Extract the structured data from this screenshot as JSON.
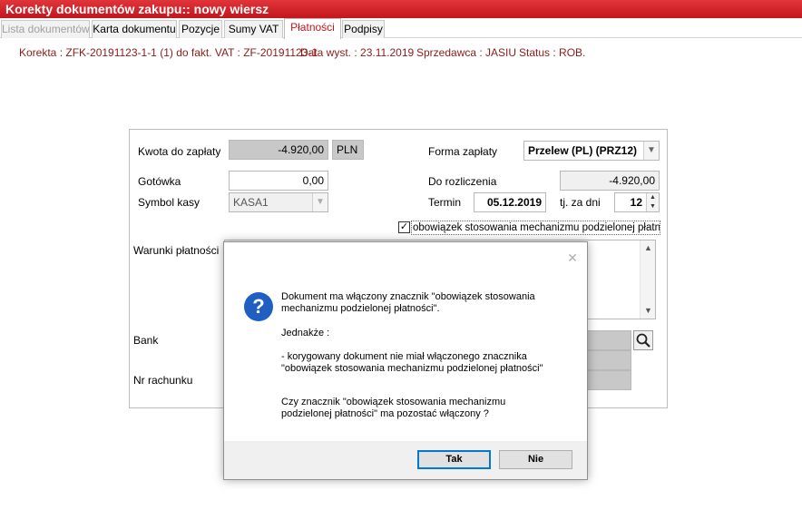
{
  "window": {
    "title": "Korekty dokumentów zakupu:: nowy wiersz"
  },
  "tabs": [
    {
      "label": "Lista dokumentów"
    },
    {
      "label": "Karta dokumentu"
    },
    {
      "label": "Pozycje"
    },
    {
      "label": "Sumy VAT"
    },
    {
      "label": "Płatności"
    },
    {
      "label": "Podpisy"
    }
  ],
  "info": {
    "korekta": "Korekta : ZFK-20191123-1-1 (1) do fakt. VAT : ZF-20191123-1",
    "data_wyst": "Data wyst. : 23.11.2019",
    "sprzedawca": "Sprzedawca : JASIU",
    "status": "Status : ROB."
  },
  "form": {
    "kwota_label": "Kwota do zapłaty",
    "kwota_value": "-4.920,00",
    "currency": "PLN",
    "forma_label": "Forma zapłaty",
    "forma_value": "Przelew (PL)  (PRZ12)",
    "gotowka_label": "Gotówka",
    "gotowka_value": "0,00",
    "do_rozliczenia_label": "Do rozliczenia",
    "do_rozliczenia_value": "-4.920,00",
    "symbol_kasy_label": "Symbol kasy",
    "symbol_kasy_value": "KASA1",
    "termin_label": "Termin",
    "termin_value": "05.12.2019",
    "tj_za_dni_label": "tj. za dni",
    "dni_value": "12",
    "split_payment_label": "obowiązek stosowania mechanizmu podzielonej płatności",
    "split_payment_checked": true,
    "warunki_label": "Warunki płatności",
    "bank_label": "Bank",
    "nr_rachunku_label": "Nr rachunku"
  },
  "dialog": {
    "line1": "Dokument ma włączony znacznik \"obowiązek stosowania\nmechanizmu podzielonej płatności\".",
    "line2": "Jednakże :",
    "line3": "- korygowany dokument nie miał włączonego znacznika\n\"obowiązek stosowania mechanizmu podzielonej płatności\"",
    "line4": "Czy znacznik \"obowiązek stosowania mechanizmu\npodzielonej płatności\" ma pozostać włączony ?",
    "yes_label": "Tak",
    "no_label": "Nie"
  },
  "colors": {
    "titlebar": "#c4151c",
    "active_tab_text": "#c4151c",
    "info_text": "#8b1a1a",
    "question_icon": "#1f5fc2"
  },
  "icons": {
    "dialog": "question-icon",
    "bank_lookup": "search-icon"
  }
}
